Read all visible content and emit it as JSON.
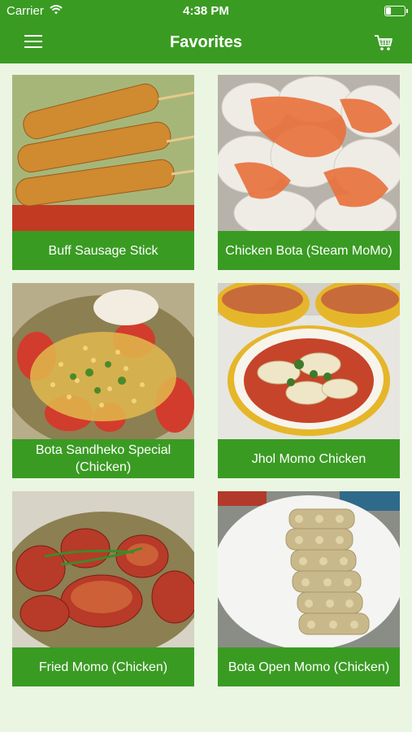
{
  "status_bar": {
    "carrier": "Carrier",
    "time": "4:38 PM"
  },
  "nav": {
    "title": "Favorites",
    "icons": [
      "hamburger-menu-icon",
      "shopping-cart-icon"
    ]
  },
  "favorites": [
    {
      "name": "Buff Sausage Stick"
    },
    {
      "name": "Chicken Bota (Steam MoMo)"
    },
    {
      "name": "Bota Sandheko Special (Chicken)"
    },
    {
      "name": "Jhol Momo Chicken"
    },
    {
      "name": "Fried Momo (Chicken)"
    },
    {
      "name": "Bota Open Momo (Chicken)"
    }
  ],
  "colors": {
    "primary": "#3a9b23",
    "background": "#eaf6e2"
  }
}
